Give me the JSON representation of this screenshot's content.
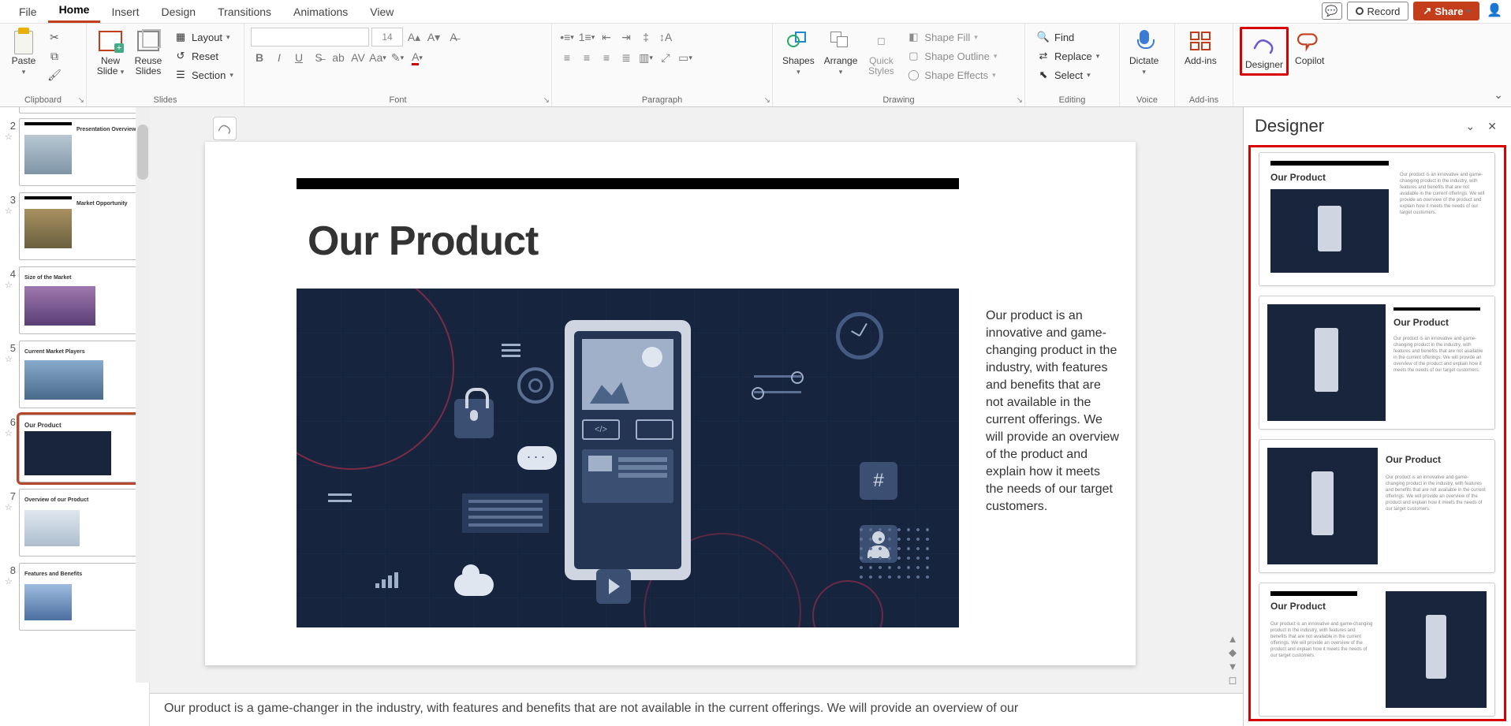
{
  "menu": {
    "tabs": [
      "File",
      "Home",
      "Insert",
      "Design",
      "Transitions",
      "Animations",
      "View"
    ],
    "active": 1,
    "record": "Record",
    "share": "Share"
  },
  "ribbon": {
    "clipboard": {
      "label": "Clipboard",
      "paste": "Paste"
    },
    "slides": {
      "label": "Slides",
      "new_slide": "New\nSlide",
      "reuse": "Reuse\nSlides",
      "layout": "Layout",
      "reset": "Reset",
      "section": "Section"
    },
    "font": {
      "label": "Font",
      "size_value": "14"
    },
    "paragraph": {
      "label": "Paragraph"
    },
    "drawing": {
      "label": "Drawing",
      "shapes": "Shapes",
      "arrange": "Arrange",
      "quick_styles": "Quick\nStyles",
      "shape_fill": "Shape Fill",
      "shape_outline": "Shape Outline",
      "shape_effects": "Shape Effects"
    },
    "editing": {
      "label": "Editing",
      "find": "Find",
      "replace": "Replace",
      "select": "Select"
    },
    "voice": {
      "label": "Voice",
      "dictate": "Dictate"
    },
    "addins": {
      "label": "Add-ins",
      "addins_btn": "Add-ins"
    },
    "designer": {
      "btn": "Designer"
    },
    "copilot": {
      "btn": "Copilot"
    }
  },
  "thumbnails": [
    {
      "num": "2",
      "title": "Presentation Overview"
    },
    {
      "num": "3",
      "title": "Market Opportunity"
    },
    {
      "num": "4",
      "title": "Size of the Market"
    },
    {
      "num": "5",
      "title": "Current Market Players"
    },
    {
      "num": "6",
      "title": "Our Product"
    },
    {
      "num": "7",
      "title": "Overview of our Product"
    },
    {
      "num": "8",
      "title": "Features and Benefits"
    }
  ],
  "selected_thumb": 4,
  "slide": {
    "title": "Our Product",
    "body": "Our product is an innovative and game-changing product in the industry, with features and benefits that are not available in the current offerings. We will provide an overview of the product and explain how it meets the needs of our target customers.",
    "hash_glyph": "#"
  },
  "notes": "Our product is a game-changer in the industry, with features and benefits that are not available in the current offerings. We will provide an overview of our",
  "designer": {
    "title": "Designer",
    "sug_title": "Our Product",
    "sug_text": "Our product is an innovative and game-changing product in the industry, with features and benefits that are not available in the current offerings. We will provide an overview of the product and explain how it meets the needs of our target customers."
  }
}
